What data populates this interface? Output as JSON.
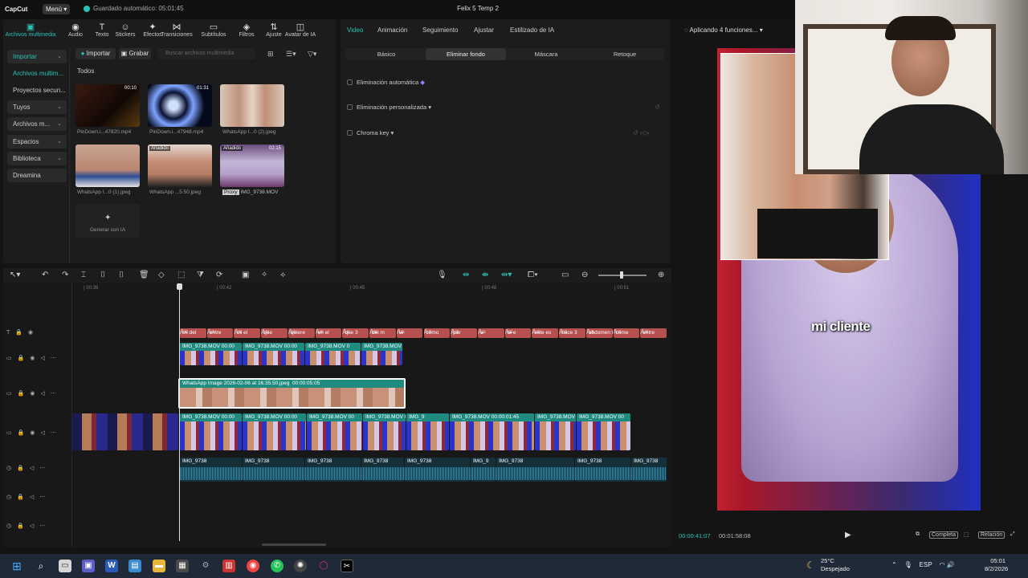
{
  "topbar": {
    "logo": "CapCut",
    "menu_label": "Menú",
    "autosave": "Guardado automático: 05:01:45",
    "project_title": "Felix 5 Temp 2"
  },
  "toolbar": {
    "tools": [
      {
        "label": "Archivos multimedia",
        "icon": "media-icon",
        "active": true
      },
      {
        "label": "Audio",
        "icon": "audio-icon"
      },
      {
        "label": "Texto",
        "icon": "text-icon"
      },
      {
        "label": "Stickers",
        "icon": "sticker-icon"
      },
      {
        "label": "Efectos",
        "icon": "effects-icon"
      },
      {
        "label": "Transiciones",
        "icon": "transitions-icon"
      },
      {
        "label": "Subtítulos",
        "icon": "subtitles-icon"
      },
      {
        "label": "Filtros",
        "icon": "filters-icon"
      },
      {
        "label": "Ajuste",
        "icon": "adjust-icon"
      },
      {
        "label": "Avatar de IA",
        "icon": "avatar-icon"
      }
    ]
  },
  "sidebar": {
    "items": [
      {
        "label": "Importar",
        "chevron": true
      },
      {
        "label": "Archivos multim..."
      },
      {
        "label": "Proyectos secun..."
      },
      {
        "label": "Tuyos",
        "chevron": true
      },
      {
        "label": "Archivos m...",
        "chevron": true
      },
      {
        "label": "Espacios",
        "chevron": true
      },
      {
        "label": "Biblioteca",
        "chevron": true
      },
      {
        "label": "Dreamina"
      }
    ]
  },
  "media": {
    "import_label": "Importar",
    "record_label": "Grabar",
    "search_placeholder": "Buscar archivos multimedia",
    "filter_label": "Todos",
    "items": [
      {
        "name": "PinDown.i...47820.mp4",
        "duration": "00:10",
        "tag": ""
      },
      {
        "name": "PinDown.i...47948.mp4",
        "duration": "01:31",
        "tag": ""
      },
      {
        "name": "WhatsApp I...0 (2).jpeg",
        "duration": "",
        "tag": ""
      },
      {
        "name": "WhatsApp I...0 (1).jpeg",
        "duration": "",
        "tag": ""
      },
      {
        "name": "WhatsApp ...5.50.jpeg",
        "duration": "",
        "tag": "Añadido"
      },
      {
        "name": "IMG_9738.MOV",
        "duration": "02:15",
        "tag": "Añadido",
        "proxy": "Proxy"
      }
    ],
    "generate_label": "Generar con IA"
  },
  "properties": {
    "tabs": [
      "Video",
      "Animación",
      "Seguimiento",
      "Ajustar",
      "Estilizado de IA"
    ],
    "subtabs": [
      "Básico",
      "Eliminar fondo",
      "Máscara",
      "Retoque"
    ],
    "options": [
      "Eliminación automática",
      "Eliminación personalizada",
      "Chroma key"
    ]
  },
  "player": {
    "status": "Aplicando 4 funciones...",
    "caption": "mi cliente",
    "time_current": "00:00:41:07",
    "time_total": "00:01:58:08",
    "full_label": "Completa",
    "ratio_label": "Relación"
  },
  "timeline": {
    "ticks": [
      "00:39",
      "00:42",
      "00:45",
      "00:48",
      "00:51"
    ],
    "text_clips": [
      "mi del",
      "entre",
      "mi el",
      "que",
      "quiere",
      "en el",
      "que 3",
      "del m",
      "la",
      "cómo",
      "par",
      "a",
      "te e",
      "este es",
      "hace 3",
      "abdomen te",
      "come",
      "entre"
    ],
    "overlay_clips": [
      {
        "label": "IMG_9738.MOV",
        "time": "00:00"
      },
      {
        "label": "IMG_9738.MOV",
        "time": "00:00"
      },
      {
        "label": "IMG_9738.MOV",
        "time": "0"
      },
      {
        "label": "IMG_9738.MOV",
        "time": ""
      }
    ],
    "selected_clip": {
      "label": "WhatsApp Image 2026-02-06 at 16.35.50.jpeg",
      "time": "00:00:05:05"
    },
    "main_clips": [
      {
        "label": "IMG_9738.MOV",
        "time": "00:00"
      },
      {
        "label": "IMG_9738.MOV",
        "time": "00:00"
      },
      {
        "label": "IMG_9738.MOV",
        "time": "00"
      },
      {
        "label": "IMG_9738.MOV",
        "time": "00:00"
      },
      {
        "label": "IMG_9",
        "time": ""
      },
      {
        "label": "IMG_9738.MOV",
        "time": "00:00:01:45"
      },
      {
        "label": "IMG_9738.MOV",
        "time": ""
      },
      {
        "label": "IMG_9738.MOV",
        "time": "00"
      }
    ],
    "audio_clips": [
      "IMG_9738",
      "IMG_9738",
      "IMG_9738",
      "IMG_9738",
      "IMG_9738",
      "IMG_9",
      "IMG_9738",
      "IMG_9738",
      "IMG_9738"
    ]
  },
  "taskbar": {
    "temp": "25°C",
    "weather": "Despejado",
    "lang": "ESP",
    "time": "05:01",
    "date": "8/2/2026"
  },
  "colors": {
    "accent": "#29c2b7",
    "text_clip": "#b5504e",
    "video_clip": "#1f8a7f",
    "audio_wave": "#2e8fb4"
  }
}
